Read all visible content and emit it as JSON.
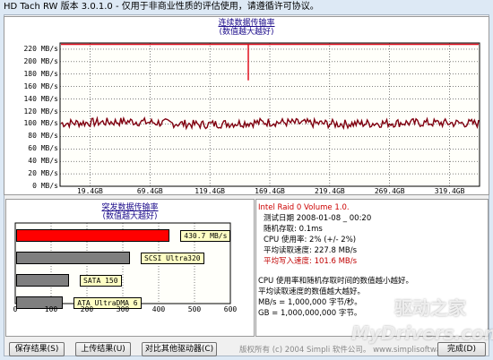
{
  "window": {
    "title": "HD Tach RW 版本 3.0.1.0  - 仅用于非商业性质的评估使用，请遵循许可协议。"
  },
  "sequential": {
    "title_line1": "连续数据传输率",
    "title_line2": "(数值越大越好)",
    "y_ticks": [
      "220 MB/s",
      "200 MB/s",
      "180 MB/s",
      "160 MB/s",
      "140 MB/s",
      "120 MB/s",
      "100 MB/s",
      "80 MB/s",
      "60 MB/s",
      "40 MB/s",
      "20 MB/s",
      "0 MB/s"
    ],
    "x_ticks": [
      "19.4GB",
      "69.4GB",
      "119.4GB",
      "169.4GB",
      "219.4GB",
      "269.4GB",
      "319.4GB"
    ]
  },
  "chart_data": [
    {
      "type": "line",
      "x": [
        "19.4GB",
        "69.4GB",
        "119.4GB",
        "169.4GB",
        "219.4GB",
        "269.4GB",
        "319.4GB"
      ],
      "series": [
        {
          "values": [
            101,
            104,
            99,
            103,
            100,
            102,
            101
          ]
        },
        {
          "values": [
            227.8,
            227.8,
            227.8,
            227.8,
            227.8,
            227.8,
            227.8
          ]
        }
      ],
      "ylim": [
        0,
        230
      ],
      "grid": true,
      "title": "连续数据传输率",
      "subtitle": "(数值越大越好)"
    },
    {
      "type": "bar",
      "title": "突发数据传输率",
      "subtitle": "(数值越大越好)",
      "categories": [
        "430.7 MB/s",
        "SCSI Ultra320",
        "SATA 150",
        "ATA UltraDMA 6"
      ],
      "values": [
        430.7,
        320,
        150,
        133
      ],
      "xlim": [
        0,
        600
      ],
      "x_ticks": [
        "0",
        "100",
        "200",
        "300",
        "400",
        "500",
        "600"
      ]
    }
  ],
  "burst": {
    "title_line1": "突发数据传输率",
    "title_line2": "(数值越大越好)",
    "bars": [
      {
        "label": "430.7 MB/s",
        "value": 430.7,
        "color": "#ff0000"
      },
      {
        "label": "SCSI Ultra320",
        "value": 320,
        "color": "#7f7f7f"
      },
      {
        "label": "SATA 150",
        "value": 150,
        "color": "#7f7f7f"
      },
      {
        "label": "ATA UltraDMA 6",
        "value": 133,
        "color": "#7f7f7f"
      }
    ],
    "x_ticks": [
      "0",
      "100",
      "200",
      "300",
      "400",
      "500",
      "600"
    ]
  },
  "info": {
    "drive_name": "Intel Raid 0 Volume 1.0.",
    "test_date": "测试日期 2008-01-08 _ 00:20",
    "random_access": "随机存取: 0.1ms",
    "cpu_usage": "CPU 使用率: 2% (+/- 2%)",
    "avg_read": "平均读取速度: 227.8 MB/s",
    "avg_write": "平均写入速度: 101.6 MB/s",
    "note1": "CPU 使用率和随机存取时间的数值越小越好。",
    "note2": "平均读取速度的数值越大越好。",
    "note3": "MB/s = 1,000,000 字节/秒。",
    "note4": "GB = 1,000,000,000 字节。"
  },
  "buttons": {
    "save": "保存结果(S)",
    "upload": "上传结果(U)",
    "compare": "对比其他驱动器(C)",
    "done": "完成(D)"
  },
  "footer": {
    "copyright": "版权所有 (c) 2004 Simpli 软件公司。 www.simplisoftware.com"
  },
  "watermark": {
    "chinese": "驱动之家",
    "latin": "MyDrivers.com"
  },
  "colors": {
    "read_line": "#e01020",
    "write_line": "#800010",
    "title_blue": "#1a0a8a",
    "write_text": "#c00000",
    "drive_name": "#cc0000"
  }
}
